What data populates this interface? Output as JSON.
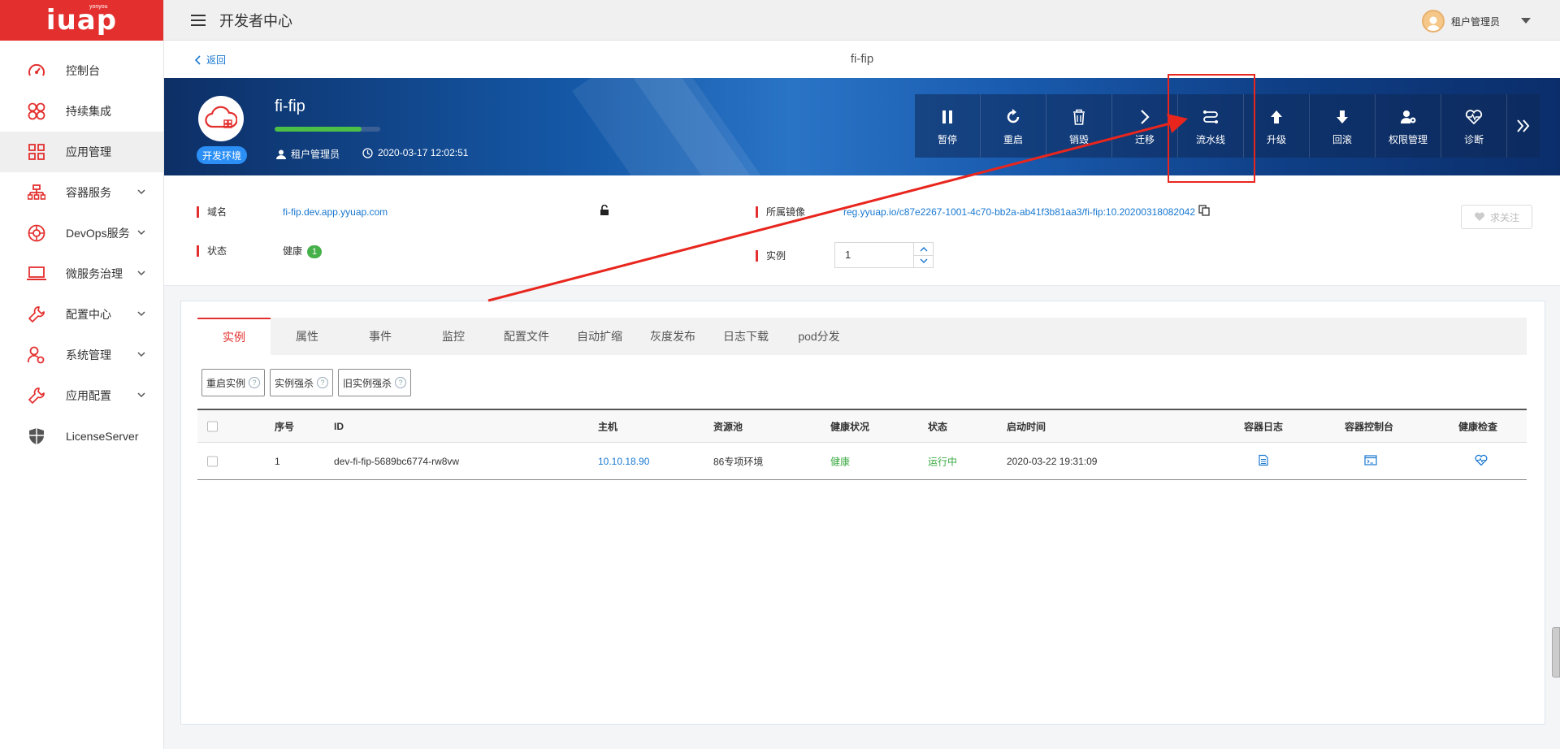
{
  "brand": {
    "logo": "iuap",
    "logo_small": "yonyou",
    "accent": "#e3302f"
  },
  "topbar": {
    "title": "开发者中心",
    "user": "租户管理员"
  },
  "sidebar": {
    "items": [
      {
        "label": "控制台",
        "icon": "dashboard-icon"
      },
      {
        "label": "持续集成",
        "icon": "integration-icon"
      },
      {
        "label": "应用管理",
        "icon": "grid-icon",
        "active": true
      },
      {
        "label": "容器服务",
        "icon": "sitemap-icon",
        "expandable": true
      },
      {
        "label": "DevOps服务",
        "icon": "devops-icon",
        "expandable": true
      },
      {
        "label": "微服务治理",
        "icon": "laptop-icon",
        "expandable": true
      },
      {
        "label": "配置中心",
        "icon": "wrench-icon",
        "expandable": true
      },
      {
        "label": "系统管理",
        "icon": "user-gear-icon",
        "expandable": true
      },
      {
        "label": "应用配置",
        "icon": "wrench-icon",
        "expandable": true
      },
      {
        "label": "LicenseServer",
        "icon": "shield-icon"
      }
    ]
  },
  "page": {
    "back": "返回",
    "title": "fi-fip"
  },
  "app": {
    "name": "fi-fip",
    "env": "开发环境",
    "owner": "租户管理员",
    "created": "2020-03-17 12:02:51",
    "health_progress": 0.82
  },
  "toolbar": {
    "buttons": [
      {
        "label": "暂停",
        "icon": "pause-icon"
      },
      {
        "label": "重启",
        "icon": "restart-icon"
      },
      {
        "label": "销毁",
        "icon": "trash-icon"
      },
      {
        "label": "迁移",
        "icon": "chevron-right-icon"
      },
      {
        "label": "流水线",
        "icon": "pipeline-icon"
      },
      {
        "label": "升级",
        "icon": "upgrade-icon"
      },
      {
        "label": "回滚",
        "icon": "rollback-icon"
      },
      {
        "label": "权限管理",
        "icon": "user-lock-icon"
      },
      {
        "label": "诊断",
        "icon": "heart-pulse-icon"
      }
    ]
  },
  "info": {
    "domain_label": "域名",
    "domain_value": "fi-fip.dev.app.yyuap.com",
    "status_label": "状态",
    "status_value": "健康",
    "status_count": "1",
    "image_label": "所属镜像",
    "image_value": "reg.yyuap.io/c87e2267-1001-4c70-bb2a-ab41f3b81aa3/fi-fip:10.20200318082042",
    "instance_label": "实例",
    "instance_value": "1",
    "follow": "求关注"
  },
  "tabs": [
    "实例",
    "属性",
    "事件",
    "监控",
    "配置文件",
    "自动扩缩",
    "灰度发布",
    "日志下载",
    "pod分发"
  ],
  "actions": [
    "重启实例",
    "实例强杀",
    "旧实例强杀"
  ],
  "table": {
    "headers": {
      "seq": "序号",
      "id": "ID",
      "host": "主机",
      "pool": "资源池",
      "health": "健康状况",
      "state": "状态",
      "start": "启动时间",
      "log": "容器日志",
      "console": "容器控制台",
      "check": "健康检查"
    },
    "rows": [
      {
        "seq": "1",
        "id": "dev-fi-fip-5689bc6774-rw8vw",
        "host": "10.10.18.90",
        "pool": "86专项环境",
        "health": "健康",
        "state": "运行中",
        "start": "2020-03-22 19:31:09"
      }
    ]
  }
}
